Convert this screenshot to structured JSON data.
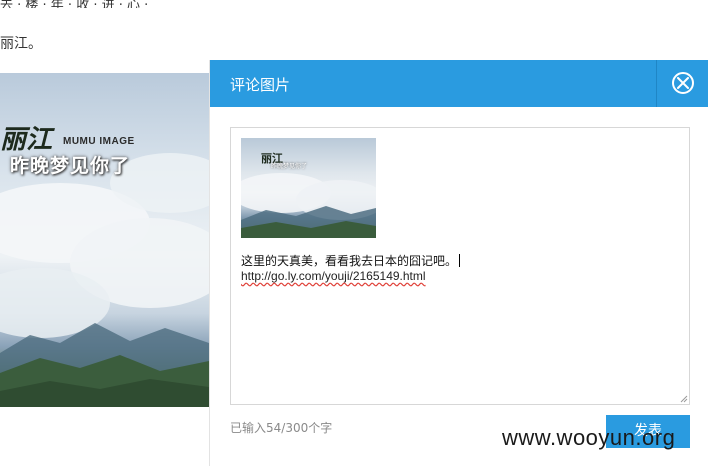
{
  "background_page": {
    "top_fragment": "去 · 楼 · 年 · 收 · 进 · 心 · 已",
    "text_line": "丽江。",
    "photo": {
      "brand": "MUMU IMAGE",
      "caption": "昨晚梦见你了",
      "logo_text": "丽江"
    }
  },
  "dialog": {
    "title": "评论图片",
    "close_icon": "close-icon",
    "editor": {
      "thumbnail_logo": "丽江",
      "thumbnail_caption": "昨晚梦见你了",
      "comment_text": "这里的天真美，看看我去日本的囧记吧。",
      "link_text": "http://go.ly.com/youji/2165149.html"
    },
    "char_count": "已输入54/300个字",
    "publish_label": "发表"
  },
  "watermark": "www.wooyun.org",
  "colors": {
    "accent": "#2a9be0",
    "header_divider": "#1f86c6",
    "muted_text": "#8a8a8a",
    "spellcheck": "#e0423a"
  }
}
